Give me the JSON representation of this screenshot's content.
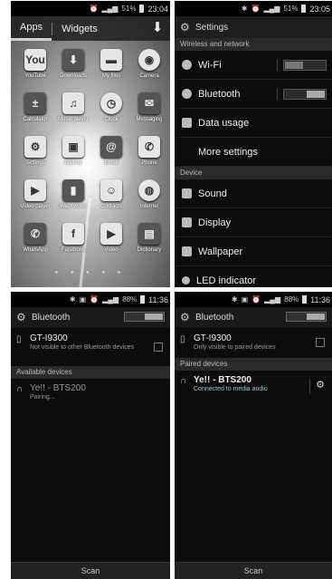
{
  "panel1": {
    "status": {
      "time": "23:04",
      "battery": "51%"
    },
    "tabs": [
      "Apps",
      "Widgets"
    ],
    "apps": [
      {
        "label": "YouTube",
        "icon": "youtube-icon",
        "glyph": "You"
      },
      {
        "label": "Downloads",
        "icon": "download-icon",
        "glyph": "⬇"
      },
      {
        "label": "My files",
        "icon": "folder-icon",
        "glyph": "▬"
      },
      {
        "label": "Camera",
        "icon": "camera-icon",
        "glyph": "◉"
      },
      {
        "label": "Calculator",
        "icon": "calculator-icon",
        "glyph": "±"
      },
      {
        "label": "Music player",
        "icon": "music-icon",
        "glyph": "♫"
      },
      {
        "label": "Clock",
        "icon": "clock-icon",
        "glyph": "◷"
      },
      {
        "label": "Messaging",
        "icon": "envelope-icon",
        "glyph": "✉"
      },
      {
        "label": "Settings",
        "icon": "gear-icon",
        "glyph": "⚙"
      },
      {
        "label": "Gallery",
        "icon": "gallery-icon",
        "glyph": "▣"
      },
      {
        "label": "Email",
        "icon": "email-icon",
        "glyph": "@"
      },
      {
        "label": "Phone",
        "icon": "phone-icon",
        "glyph": "✆"
      },
      {
        "label": "Video player",
        "icon": "video-icon",
        "glyph": "▶"
      },
      {
        "label": "Web/Video",
        "icon": "video-clip-icon",
        "glyph": "▮"
      },
      {
        "label": "Contacts",
        "icon": "contacts-icon",
        "glyph": "☺"
      },
      {
        "label": "Internet",
        "icon": "globe-icon",
        "glyph": "◍"
      },
      {
        "label": "WhatsApp",
        "icon": "whatsapp-icon",
        "glyph": "✆"
      },
      {
        "label": "Facebook",
        "icon": "facebook-icon",
        "glyph": "f"
      },
      {
        "label": "Video",
        "icon": "video-camera-icon",
        "glyph": "▶"
      },
      {
        "label": "Dictionary",
        "icon": "dictionary-icon",
        "glyph": "▤"
      }
    ]
  },
  "panel2": {
    "status": {
      "time": "23:05",
      "battery": "51%"
    },
    "title": "Settings",
    "section_wireless": "Wireless and network",
    "wifi": "Wi-Fi",
    "bluetooth": "Bluetooth",
    "data_usage": "Data usage",
    "more_settings": "More settings",
    "section_device": "Device",
    "sound": "Sound",
    "display": "Display",
    "wallpaper": "Wallpaper",
    "led": "LED indicator",
    "toggle_on_glyph": "I",
    "toggle_off_glyph": "O"
  },
  "panel3": {
    "status": {
      "time": "11:36",
      "battery": "88%"
    },
    "title": "Bluetooth",
    "self_name": "GT-I9300",
    "self_status": "Not visible to other Bluetooth devices",
    "section": "Available devices",
    "device_name": "Ye!! - BTS200",
    "device_status": "Pairing...",
    "scan": "Scan"
  },
  "panel4": {
    "status": {
      "time": "11:36",
      "battery": "88%"
    },
    "title": "Bluetooth",
    "self_name": "GT-I9300",
    "self_status": "Only visible to paired devices",
    "section": "Paired devices",
    "device_name": "Ye!! - BTS200",
    "device_status": "Connected to media audio",
    "scan": "Scan"
  }
}
